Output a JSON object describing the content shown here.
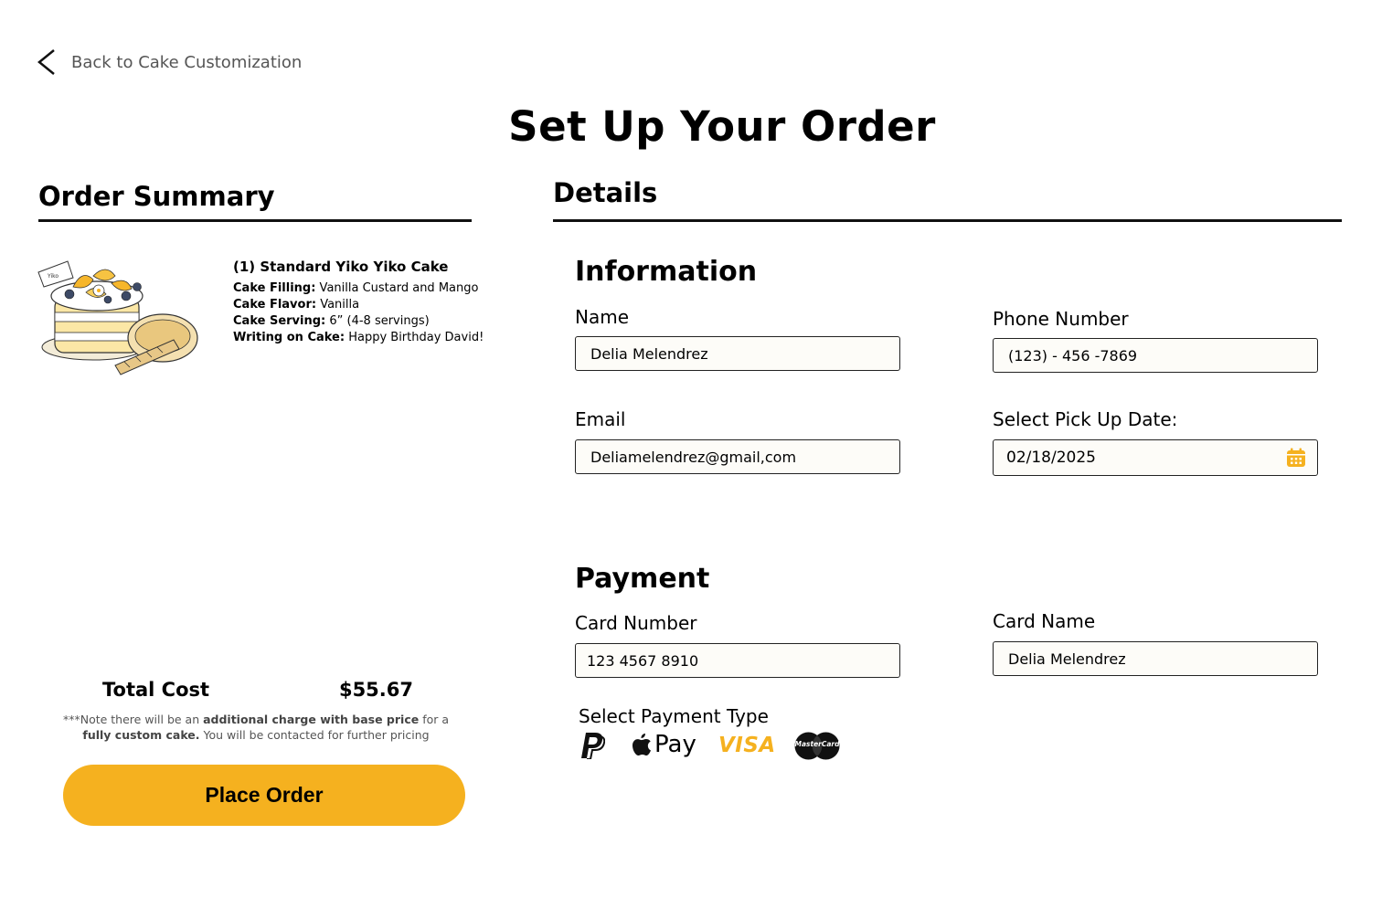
{
  "nav": {
    "back_label": "Back to Cake Customization"
  },
  "page": {
    "title": "Set Up Your Order"
  },
  "summary": {
    "heading": "Order Summary",
    "item": {
      "title": "(1) Standard Yiko Yiko Cake",
      "filling_label": "Cake Filling:",
      "filling_value": " Vanilla Custard and Mango",
      "flavor_label": "Cake Flavor:",
      "flavor_value": " Vanilla",
      "serving_label": "Cake Serving:",
      "serving_value": " 6” (4-8 servings)",
      "writing_label": "Writing on Cake:",
      "writing_value": " Happy Birthday David!"
    },
    "total_label": "Total Cost",
    "total_value": "$55.67",
    "note_1": "***Note there will be an ",
    "note_2": "additional charge with base price",
    "note_3": " for a ",
    "note_4": "fully custom cake.",
    "note_5": " You will be contacted for further pricing",
    "place_order_label": "Place Order"
  },
  "details": {
    "heading": "Details",
    "information": {
      "heading": "Information",
      "name_label": "Name",
      "name_value": "Delia Melendrez",
      "phone_label": "Phone Number",
      "phone_value": "(123) - 456 -7869",
      "email_label": "Email",
      "email_value": "Deliamelendrez@gmail,com",
      "date_label": "Select Pick Up Date:",
      "date_value": "02/18/2025"
    },
    "payment": {
      "heading": "Payment",
      "card_number_label": "Card Number",
      "card_number_value": "123 4567 8910",
      "card_name_label": "Card Name",
      "card_name_value": "Delia Melendrez",
      "type_label": "Select Payment Type",
      "methods": [
        {
          "name": "paypal-icon"
        },
        {
          "name": "apple-pay-icon",
          "text": "Pay"
        },
        {
          "name": "visa-icon",
          "text": "VISA"
        },
        {
          "name": "mastercard-icon",
          "text": "MasterCard"
        }
      ]
    }
  },
  "colors": {
    "accent": "#f5b11f",
    "field_bg": "#fdfcf8",
    "rule": "#111111"
  }
}
